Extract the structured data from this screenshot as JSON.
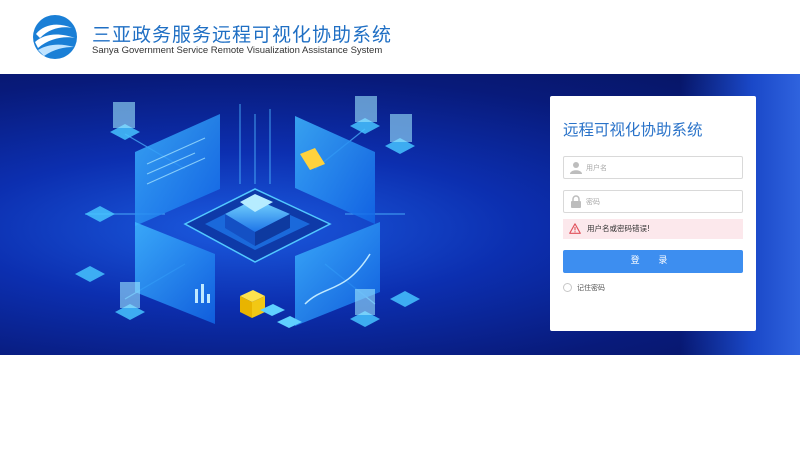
{
  "header": {
    "title_cn": "三亚政务服务远程可视化协助系统",
    "title_en": "Sanya Government Service Remote Visualization Assistance System",
    "logo_icon": "wave-logo-icon"
  },
  "login": {
    "title": "远程可视化协助系统",
    "username_placeholder": "用户名",
    "password_placeholder": "密码",
    "error_message": "用户名或密码错误!",
    "login_button": "登 录",
    "remember_label": "记住密码",
    "icons": {
      "user": "user-icon",
      "lock": "lock-icon",
      "warning": "warning-icon"
    }
  },
  "colors": {
    "brand_blue": "#1f6fc4",
    "button_blue": "#3d8ef0",
    "error_bg": "#fce8ec",
    "banner_dark": "#081a7a"
  }
}
